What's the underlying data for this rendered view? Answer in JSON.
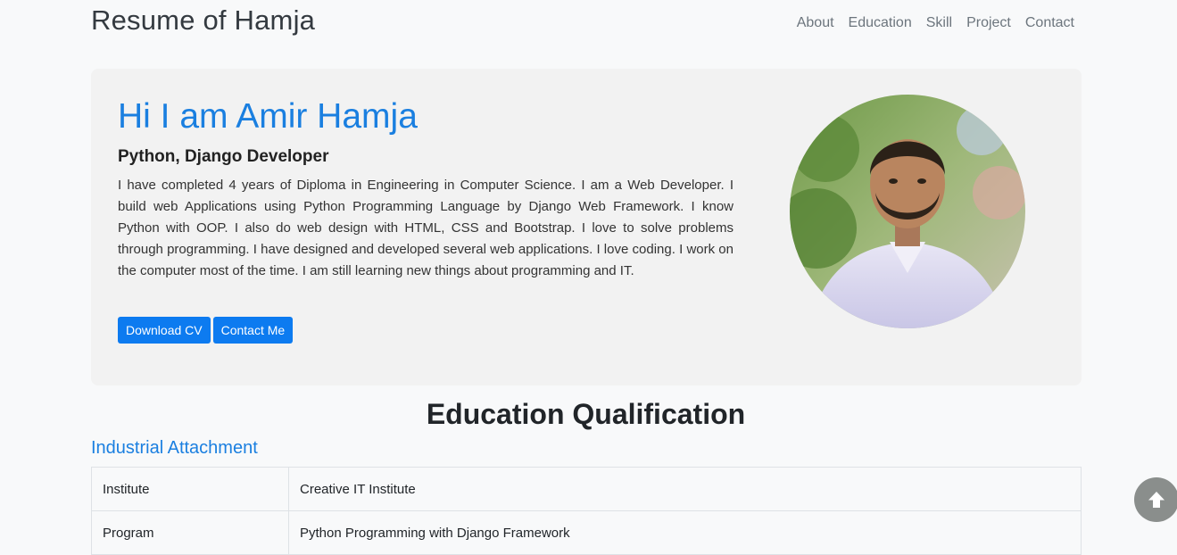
{
  "nav": {
    "brand": "Resume of Hamja",
    "links": [
      "About",
      "Education",
      "Skill",
      "Project",
      "Contact"
    ]
  },
  "hero": {
    "title": "Hi I am Amir Hamja",
    "subtitle": "Python, Django Developer",
    "description": "I have completed 4 years of Diploma in Engineering in Computer Science. I am a Web Developer. I build web Applications using Python Programming Language by Django Web Framework. I know Python with OOP. I also do web design with HTML, CSS and Bootstrap. I love to solve problems through programming. I have designed and developed several web applications. I love coding. I work on the computer most of the time. I am still learning new things about programming and IT.",
    "buttons": {
      "download": "Download CV",
      "contact": "Contact Me"
    }
  },
  "education": {
    "title": "Education Qualification",
    "attachment_title": "Industrial Attachment",
    "rows": [
      {
        "key": "Institute",
        "value": "Creative IT Institute"
      },
      {
        "key": "Program",
        "value": "Python Programming with Django Framework"
      }
    ]
  },
  "colors": {
    "accent": "#0d7bf0",
    "heading_blue": "#1a7fe0",
    "scroll_button": "#8a8e8c"
  },
  "icons": {
    "scroll_top": "arrow-up-icon",
    "profile": "profile-photo"
  }
}
